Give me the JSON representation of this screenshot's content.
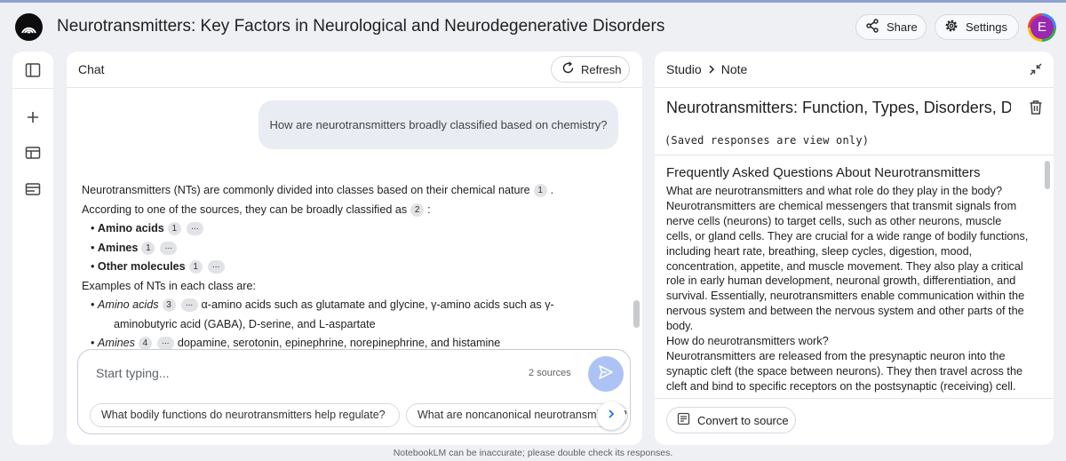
{
  "app": {
    "title": "Neurotransmitters: Key Factors in Neurological and Neurodegenerative Disorders",
    "share_label": "Share",
    "settings_label": "Settings",
    "avatar_letter": "E"
  },
  "chat": {
    "title": "Chat",
    "refresh_label": "Refresh",
    "user_message": "How are neurotransmitters broadly classified based on chemistry?",
    "answer": {
      "intro_1": "Neurotransmitters (NTs) are commonly divided into classes based on their chemical nature",
      "intro_1_cite": "1",
      "intro_1_end": ".",
      "intro_2": "According to one of the sources, they can be broadly classified as",
      "intro_2_cite": "2",
      "intro_2_end": ":",
      "classes": [
        {
          "label": "Amino acids",
          "cite": "1",
          "more": "..."
        },
        {
          "label": "Amines",
          "cite": "1",
          "more": "..."
        },
        {
          "label": "Other molecules",
          "cite": "1",
          "more": "..."
        }
      ],
      "examples_heading": "Examples of NTs in each class are:",
      "examples": [
        {
          "label": "Amino acids",
          "cite": "3",
          "more": "...",
          "text": "α-amino acids such as glutamate and glycine, γ-amino acids such as γ-",
          "text_cont": "aminobutyric acid (GABA), D-serine, and L-aspartate"
        },
        {
          "label": "Amines",
          "cite": "4",
          "more": "...",
          "text": "dopamine, serotonin, epinephrine, norepinephrine, and histamine"
        }
      ]
    },
    "composer": {
      "placeholder": "Start typing...",
      "sources_label": "2 sources",
      "suggestions": [
        "What bodily functions do neurotransmitters help regulate?",
        "What are noncanonical neurotransmitters?"
      ]
    }
  },
  "studio": {
    "crumb_root": "Studio",
    "crumb_current": "Note",
    "note_title": "Neurotransmitters: Function, Types, Disorders, De",
    "saved_notice": "(Saved responses are view only)",
    "faq_heading": "Frequently Asked Questions About Neurotransmitters",
    "paragraphs": [
      "What are neurotransmitters and what role do they play in the body?",
      "Neurotransmitters are chemical messengers that transmit signals from nerve cells (neurons) to target cells, such as other neurons, muscle cells, or gland cells. They are crucial for a wide range of bodily functions, including heart rate, breathing, sleep cycles, digestion, mood, concentration, appetite, and muscle movement. They also play a critical role in early human development, neuronal growth, differentiation, and survival. Essentially, neurotransmitters enable communication within the nervous system and between the nervous system and other parts of the body.",
      "How do neurotransmitters work?",
      "Neurotransmitters are released from the presynaptic neuron into the synaptic cleft (the space between neurons). They then travel across the cleft and bind to specific receptors on the postsynaptic (receiving) cell."
    ],
    "convert_label": "Convert to source"
  },
  "footer": {
    "disclaimer": "NotebookLM can be inaccurate; please double check its responses."
  }
}
